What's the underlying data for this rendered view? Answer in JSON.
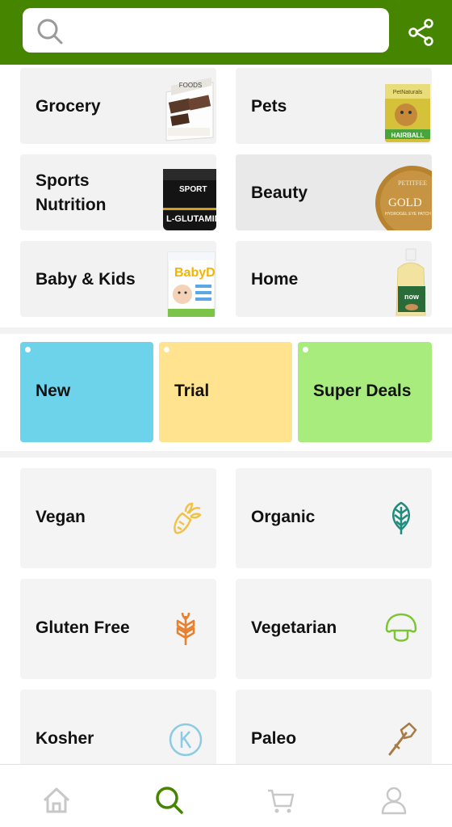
{
  "search": {
    "placeholder": ""
  },
  "categories": [
    {
      "label": "Grocery",
      "icon": "chocolate-bar-box-image"
    },
    {
      "label": "Pets",
      "icon": "pet-treats-bag-image"
    },
    {
      "label_line1": "Sports",
      "label_line2": "Nutrition",
      "icon": "l-glutamine-jar-image"
    },
    {
      "label": "Beauty",
      "icon": "gold-eye-patch-jar-image"
    },
    {
      "label": "Baby & Kids",
      "icon": "baby-vitamin-d-box-image"
    },
    {
      "label": "Home",
      "icon": "oil-bottle-image"
    }
  ],
  "product_text": {
    "foods": "FOODS",
    "sport": "SPORT",
    "glutamine": "L-GLUTAMINE",
    "gold": "GOLD",
    "petitfee": "PETITFEE",
    "patch": "HYDROGEL EYE PATCH",
    "hairball": "HAIRBALL",
    "petnat": "PetNaturals",
    "babyd": "BabyD",
    "now": "now"
  },
  "promos": [
    {
      "label": "New",
      "color": "#6dd3ea"
    },
    {
      "label": "Trial",
      "color": "#ffe38f"
    },
    {
      "label": "Super Deals",
      "color": "#a8ec7e"
    }
  ],
  "diets": [
    {
      "label": "Vegan",
      "icon": "carrot-icon",
      "color": "#efc34a"
    },
    {
      "label": "Organic",
      "icon": "leaf-icon",
      "color": "#1f8c7e"
    },
    {
      "label": "Gluten Free",
      "icon": "wheat-icon",
      "color": "#e8802e"
    },
    {
      "label": "Vegetarian",
      "icon": "mushroom-icon",
      "color": "#7cc634"
    },
    {
      "label": "Kosher",
      "icon": "kosher-k-icon",
      "color": "#8ccbe4"
    },
    {
      "label": "Paleo",
      "icon": "stone-axe-icon",
      "color": "#a97a42"
    }
  ],
  "nav": [
    {
      "name": "home-icon"
    },
    {
      "name": "search-icon",
      "active": true
    },
    {
      "name": "cart-icon"
    },
    {
      "name": "profile-icon"
    }
  ],
  "colors": {
    "brand": "#458500",
    "tile_bg": "#f2f2f2",
    "nav_inactive": "#c8c8c8"
  }
}
